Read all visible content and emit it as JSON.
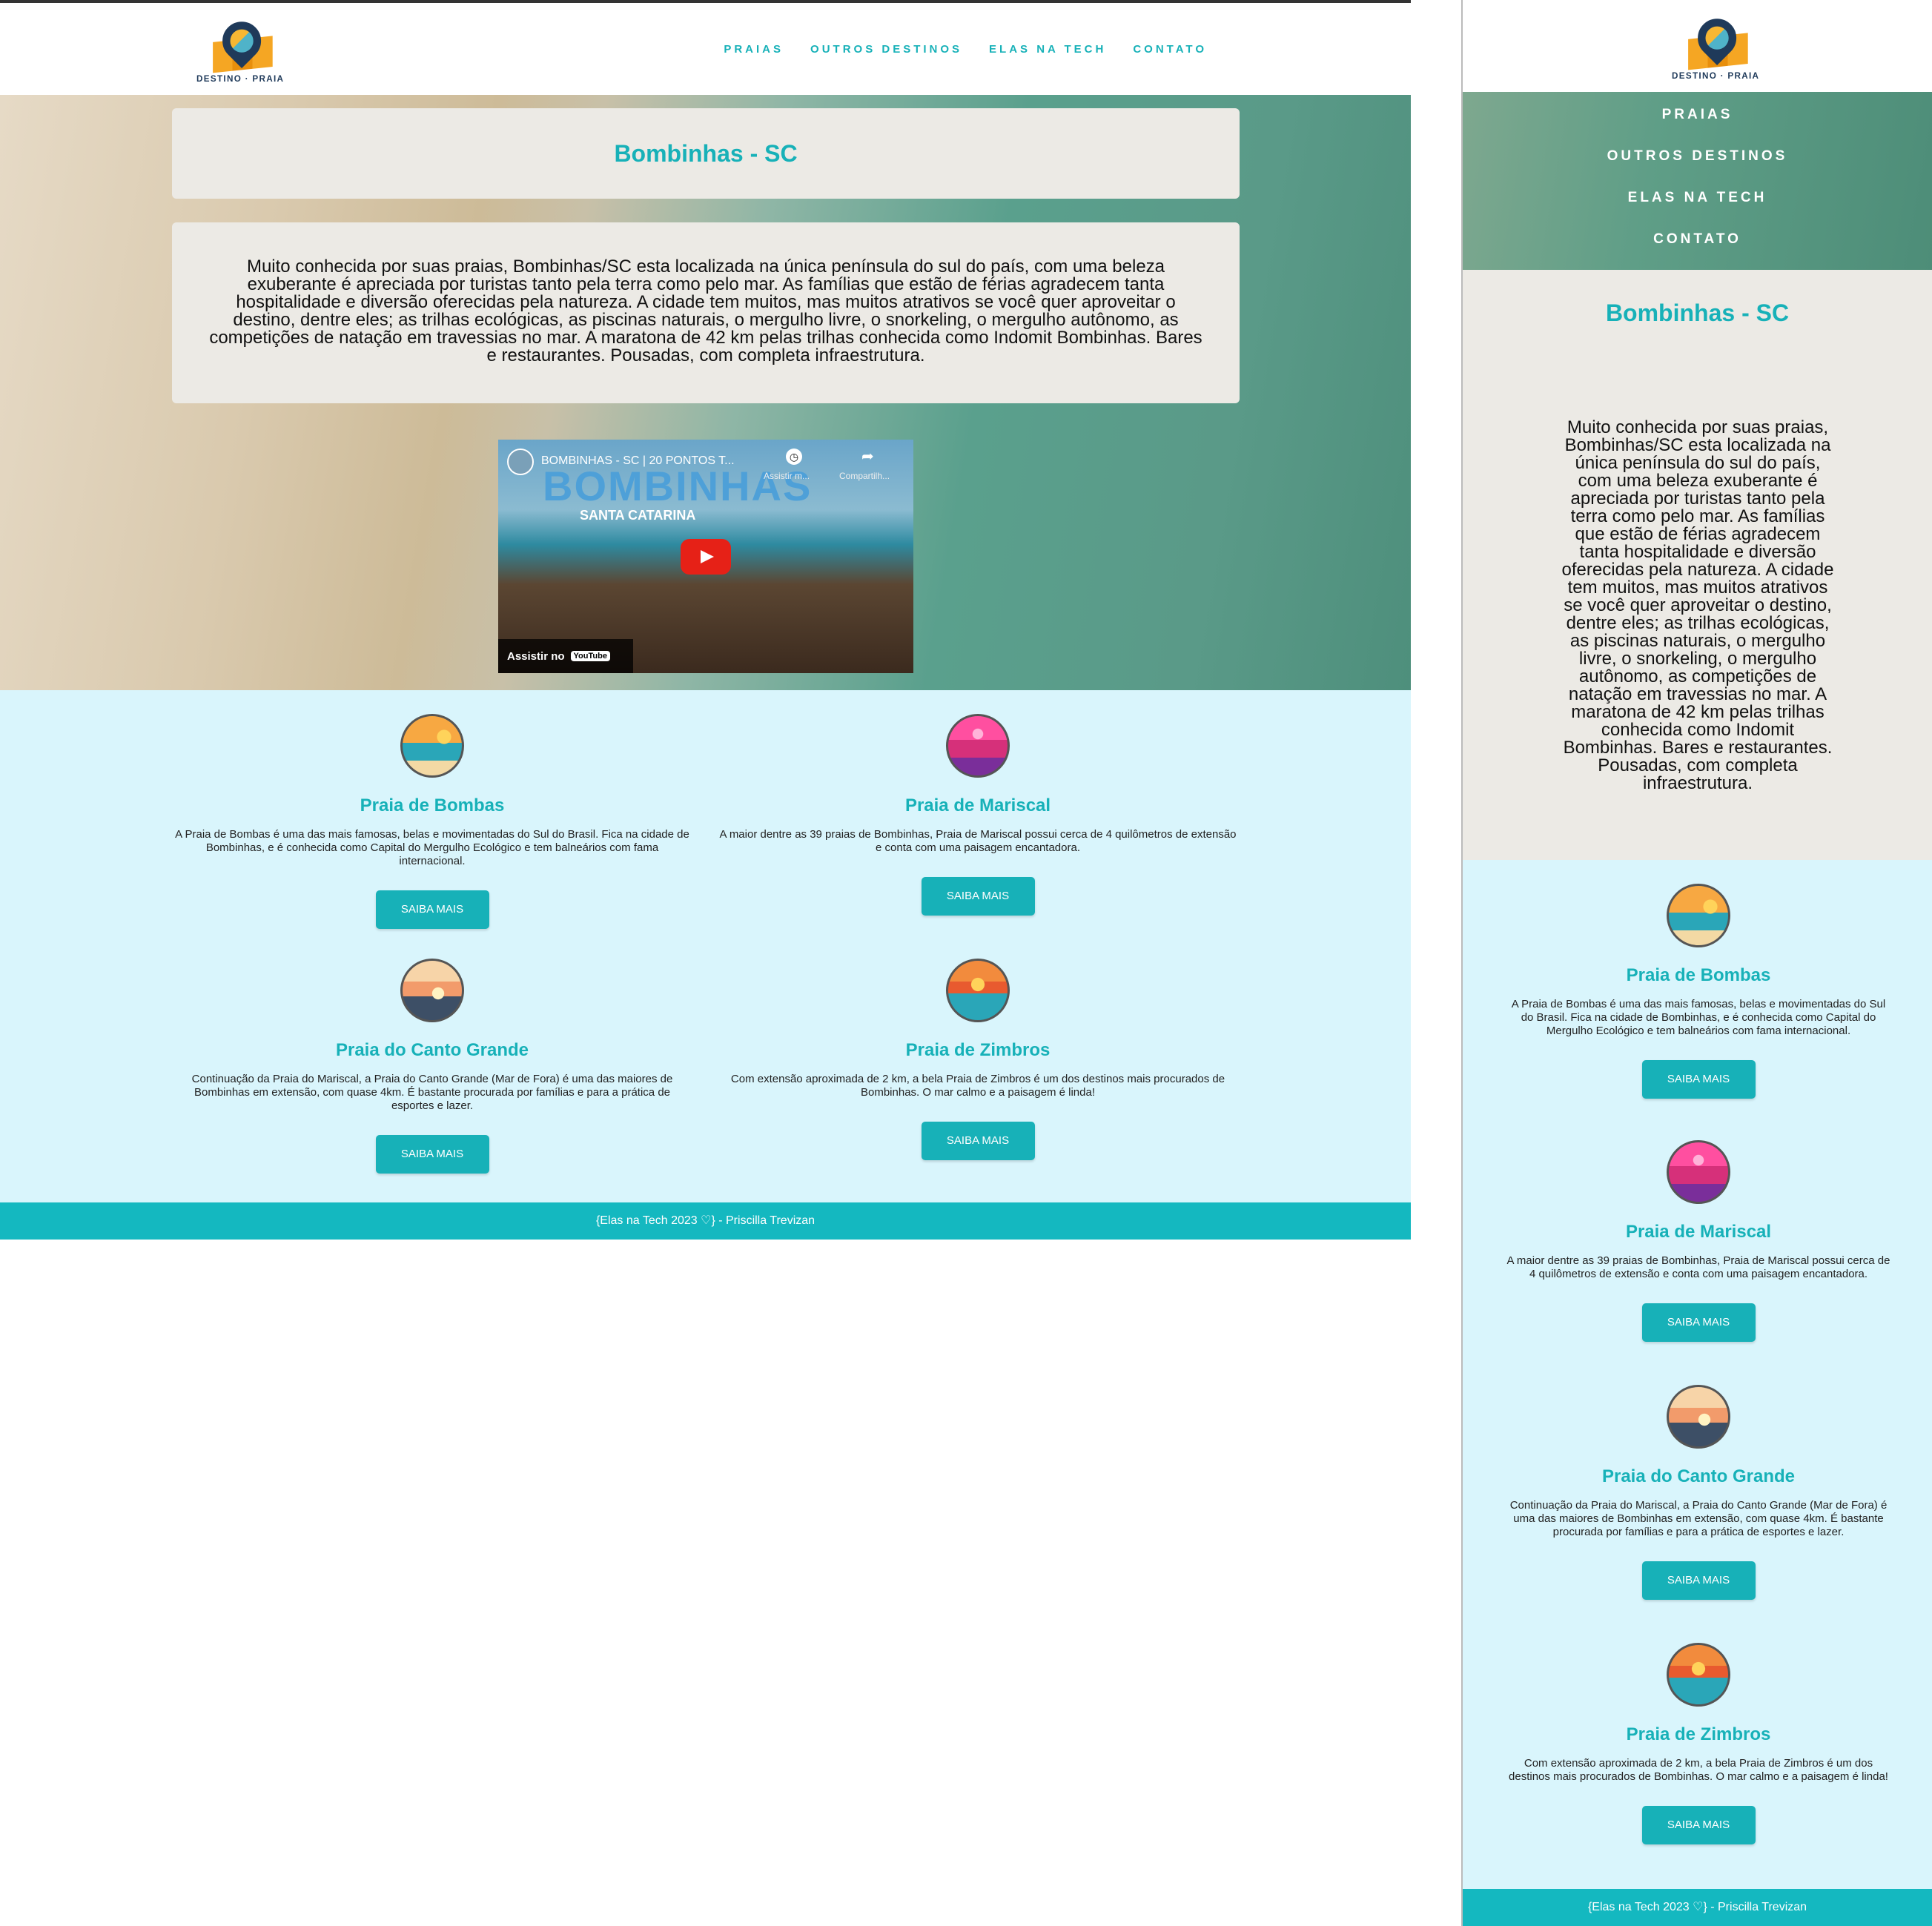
{
  "brand": {
    "logo_text": "DESTINO · PRAIA"
  },
  "nav": [
    "PRAIAS",
    "OUTROS DESTINOS",
    "ELAS NA TECH",
    "CONTATO"
  ],
  "hero": {
    "title": "Bombinhas - SC",
    "description": "Muito conhecida por suas praias, Bombinhas/SC esta localizada na única península do sul do país, com uma beleza exuberante é apreciada por turistas tanto pela terra como pelo mar. As famílias que estão de férias agradecem tanta hospitalidade e diversão oferecidas pela natureza. A cidade tem muitos, mas muitos atrativos se você quer aproveitar o destino, dentre eles; as trilhas ecológicas, as piscinas naturais, o mergulho livre, o snorkeling, o mergulho autônomo, as competições de natação em travessias no mar. A maratona de 42 km pelas trilhas conhecida como Indomit Bombinhas. Bares e restaurantes. Pousadas, com completa infraestrutura."
  },
  "video": {
    "title": "BOMBINHAS - SC | 20 PONTOS T...",
    "overlay_big": "BOMBINHAS",
    "overlay_sub": "SANTA CATARINA",
    "watch_later": "Assistir m...",
    "share": "Compartilh...",
    "watch_on": "Assistir no",
    "youtube": "YouTube"
  },
  "beaches": [
    {
      "name": "Praia de Bombas",
      "icon": "beach-sunset-icon",
      "text": "A Praia de Bombas é uma das mais famosas, belas e movimentadas do Sul do Brasil. Fica na cidade de Bombinhas, e é conhecida como Capital do Mergulho Ecológico e tem balneários com fama internacional.",
      "button": "SAIBA MAIS"
    },
    {
      "name": "Praia de Mariscal",
      "icon": "pink-palm-icon",
      "text": "A maior dentre as 39 praias de Bombinhas, Praia de Mariscal possui cerca de 4 quilômetros de extensão e conta com uma paisagem encantadora.",
      "button": "SAIBA MAIS"
    },
    {
      "name": "Praia do Canto Grande",
      "icon": "palm-sunset-icon",
      "text": "Continuação da Praia do Mariscal, a Praia do Canto Grande (Mar de Fora) é uma das maiores de Bombinhas em extensão, com quase 4km. É bastante procurada por famílias e para a prática de esportes e lazer.",
      "button": "SAIBA MAIS"
    },
    {
      "name": "Praia de Zimbros",
      "icon": "island-sunset-icon",
      "text": "Com extensão aproximada de 2 km, a bela Praia de Zimbros é um dos destinos mais procurados de Bombinhas. O mar calmo e a paisagem é linda!",
      "button": "SAIBA MAIS"
    }
  ],
  "footer": "{Elas na Tech 2023 ♡} - Priscilla Trevizan",
  "colors": {
    "accent": "#17b1b8",
    "cards_bg": "#d9f5fc",
    "panel_bg": "#eceae5"
  }
}
